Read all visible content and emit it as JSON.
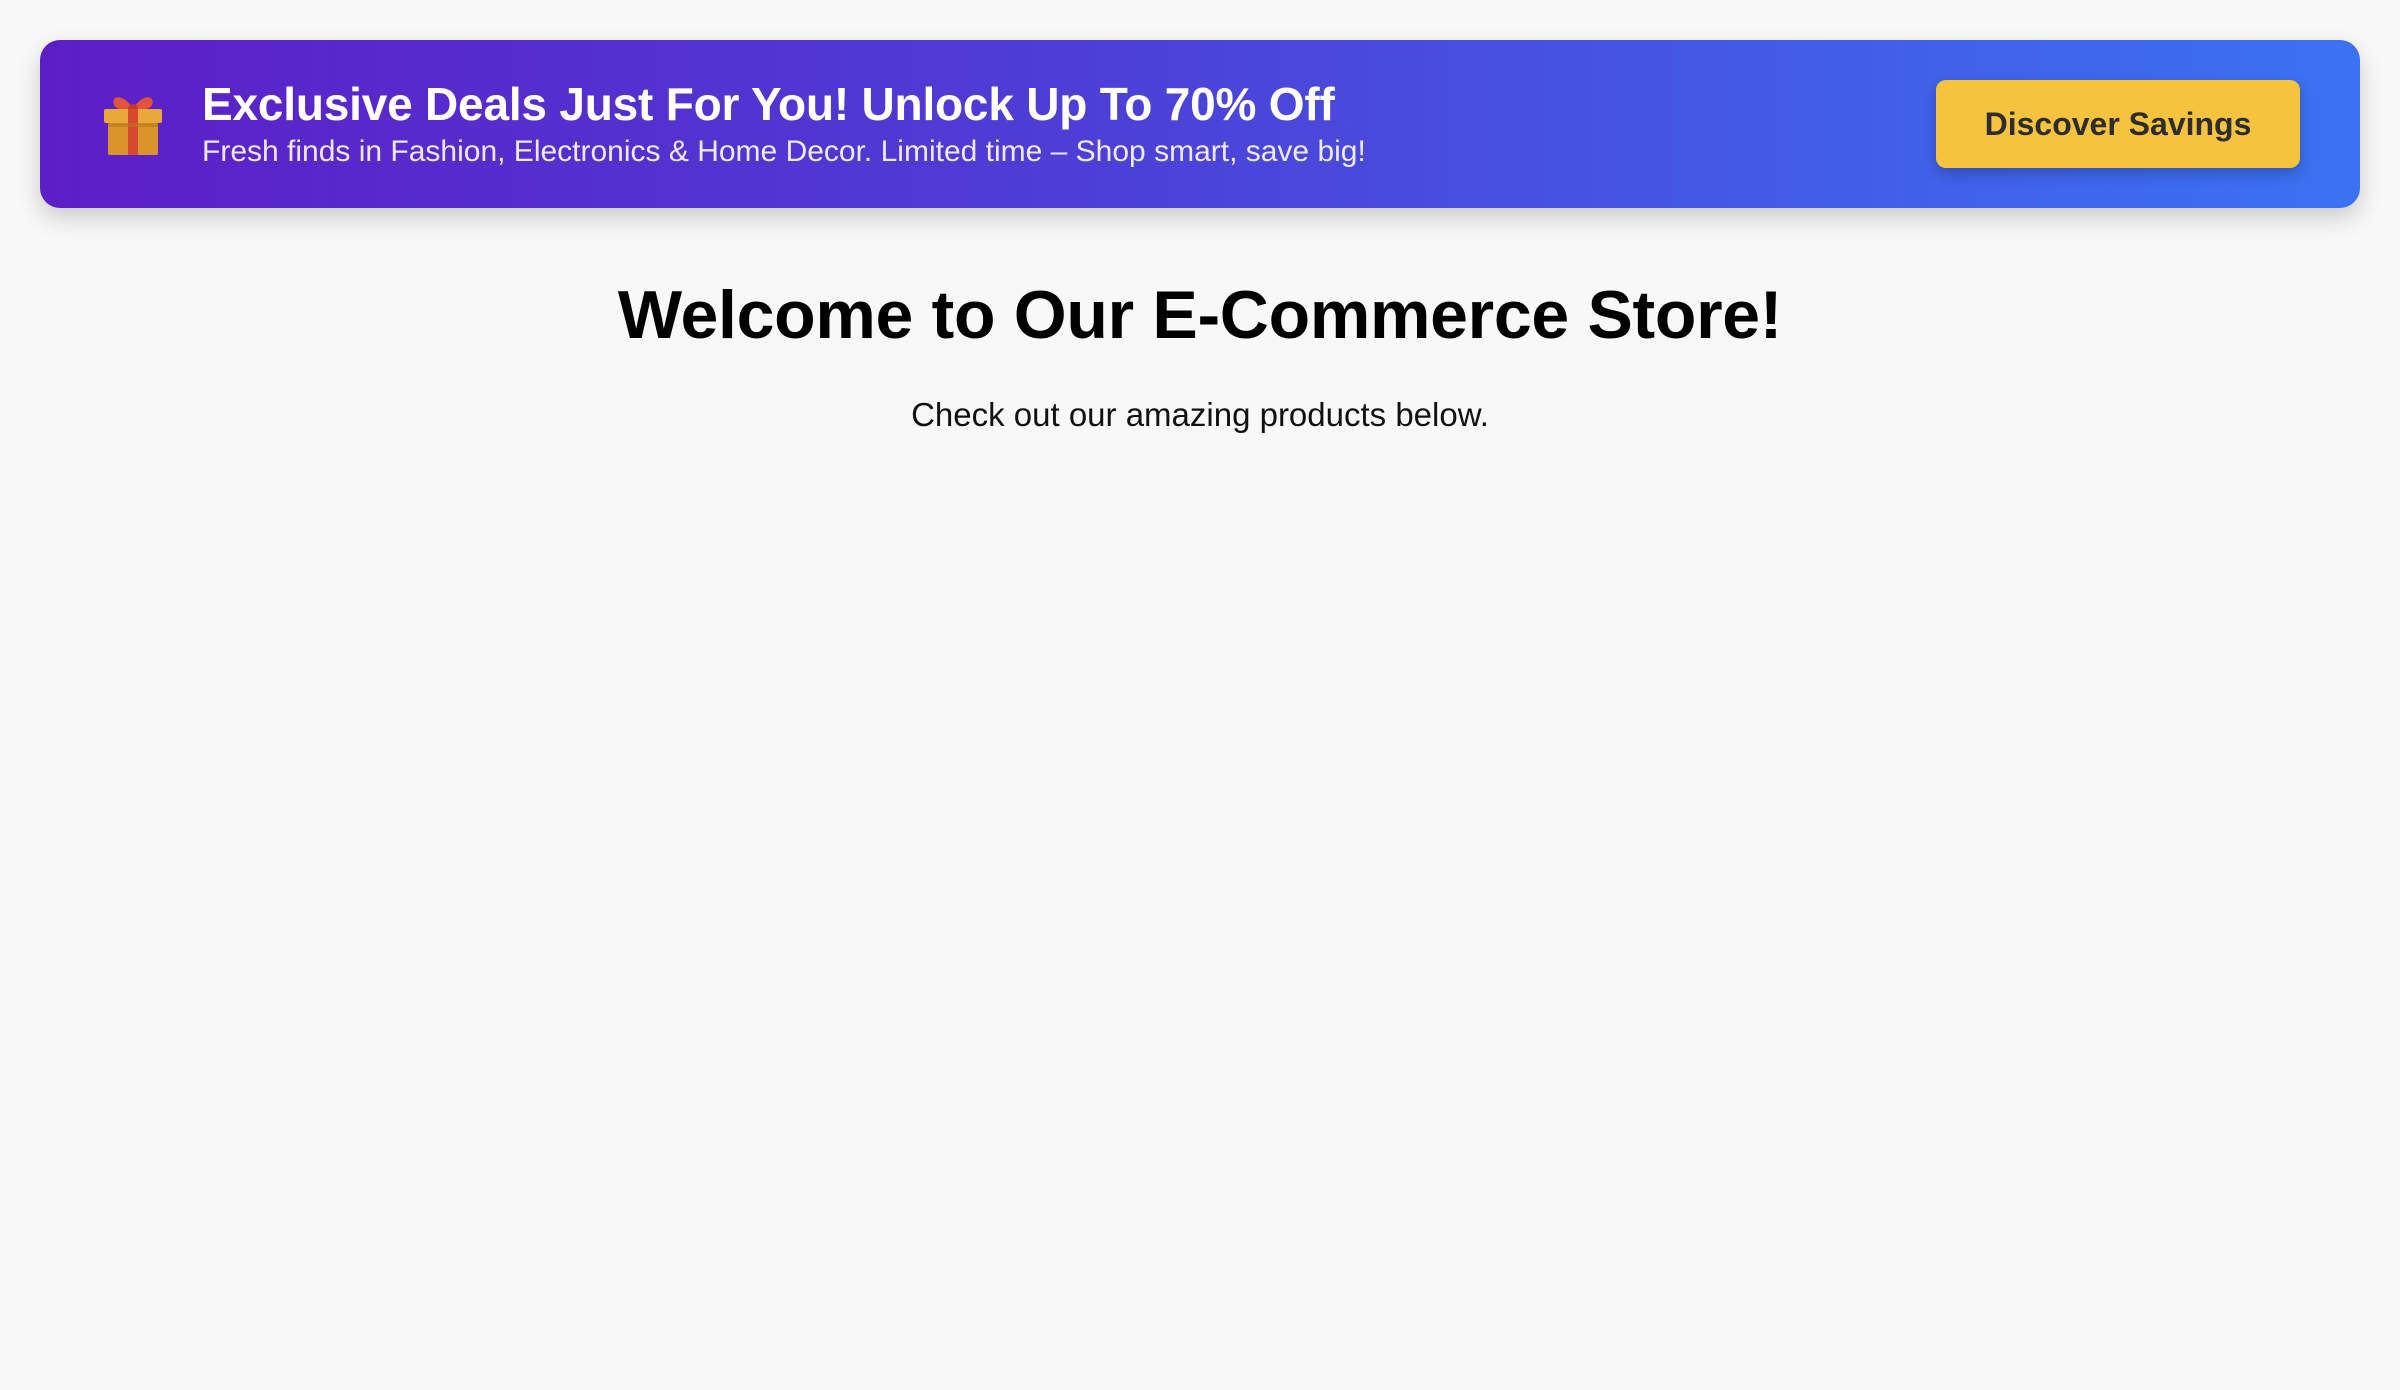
{
  "banner": {
    "icon": "gift-icon",
    "title": "Exclusive Deals Just For You! Unlock Up To 70% Off",
    "subtitle": "Fresh finds in Fashion, Electronics & Home Decor. Limited time – Shop smart, save big!",
    "cta_label": "Discover Savings",
    "gradient_start": "#5d1ec6",
    "gradient_end": "#3b72f2",
    "cta_color": "#f6c33f"
  },
  "main": {
    "title": "Welcome to Our E-Commerce Store!",
    "subtitle": "Check out our amazing products below."
  }
}
